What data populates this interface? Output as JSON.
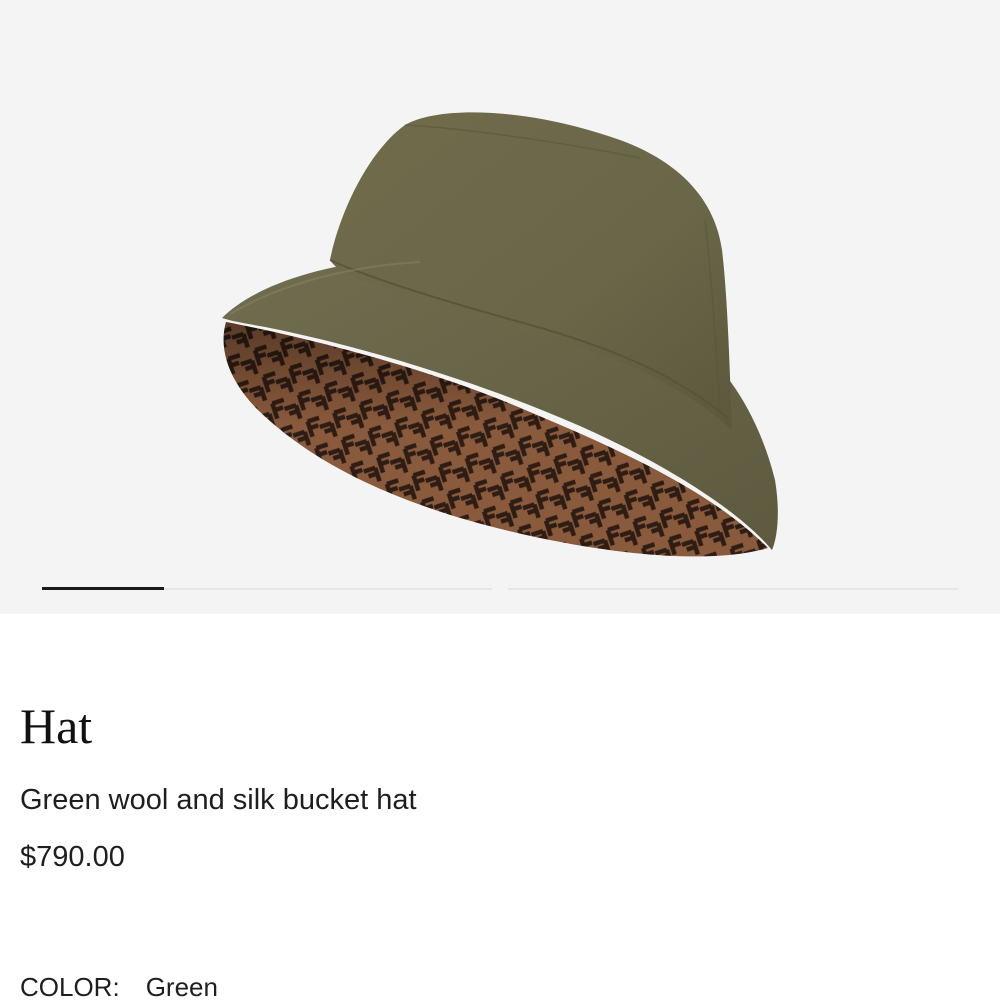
{
  "gallery": {
    "image_alt": "Green wool and silk bucket hat with FF pattern lining",
    "slide_count": 2,
    "active_slide": 1
  },
  "product": {
    "name": "Hat",
    "description": "Green wool and silk bucket hat",
    "price": "$790.00"
  },
  "color": {
    "label": "COLOR:",
    "value": "Green"
  },
  "colors": {
    "gallery_bg": "#f4f4f4",
    "hat_felt": "#6d6a4c",
    "lining_light": "#8a5a3c",
    "lining_dark": "#2e1d14",
    "text": "#1e1e1e"
  }
}
